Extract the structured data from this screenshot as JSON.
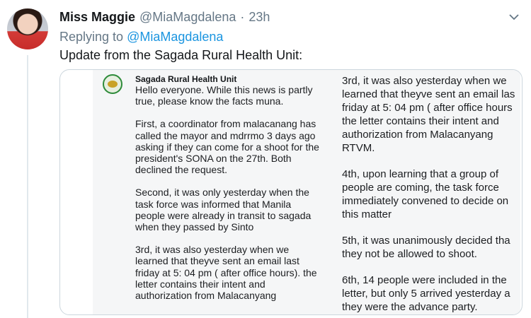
{
  "tweet": {
    "display_name": "Miss Maggie",
    "handle": "@MiaMagdalena",
    "separator": "·",
    "time": "23h",
    "replying_prefix": "Replying to",
    "replying_to": "@MiaMagdalena",
    "text": "Update from the Sagada Rural Health Unit:"
  },
  "icons": {
    "menu": "chevron-down-icon",
    "logo": "health-unit-seal-icon"
  },
  "left_card": {
    "title": "Sagada Rural Health Unit",
    "paragraphs": [
      "Hello everyone. While this news is partly true, please know the facts muna.",
      "First, a coordinator from malacanang has called the mayor and mdrrmo 3 days ago asking if they can come for a shoot for the president's SONA on the 27th. Both declined the request.",
      "Second, it was only yesterday when the task force was informed that Manila people were already in transit to sagada when they passed by Sinto",
      "3rd, it was also yesterday when we learned that theyve sent an email last friday at 5: 04 pm ( after office hours). the letter contains their intent and authorization from Malacanyang"
    ]
  },
  "right_card": {
    "paragraphs": [
      "3rd, it was also yesterday when we\nlearned that theyve sent an email las\nfriday at 5: 04 pm ( after office hours\nthe letter contains their intent and\nauthorization from Malacanyang\nRTVM.",
      "4th, upon learning that a group of\npeople are coming, the task force\nimmediately convened to decide on\nthis matter",
      "5th, it was unanimously decided tha\nthey not be allowed to shoot.",
      "6th, 14 people were included in the\nletter, but only 5 arrived yesterday a\nthey were the advance party."
    ]
  },
  "colors": {
    "link": "#1b95e0",
    "secondary_text": "#657786",
    "card_background": "#f5f6f7",
    "border": "#ccd6dd"
  }
}
